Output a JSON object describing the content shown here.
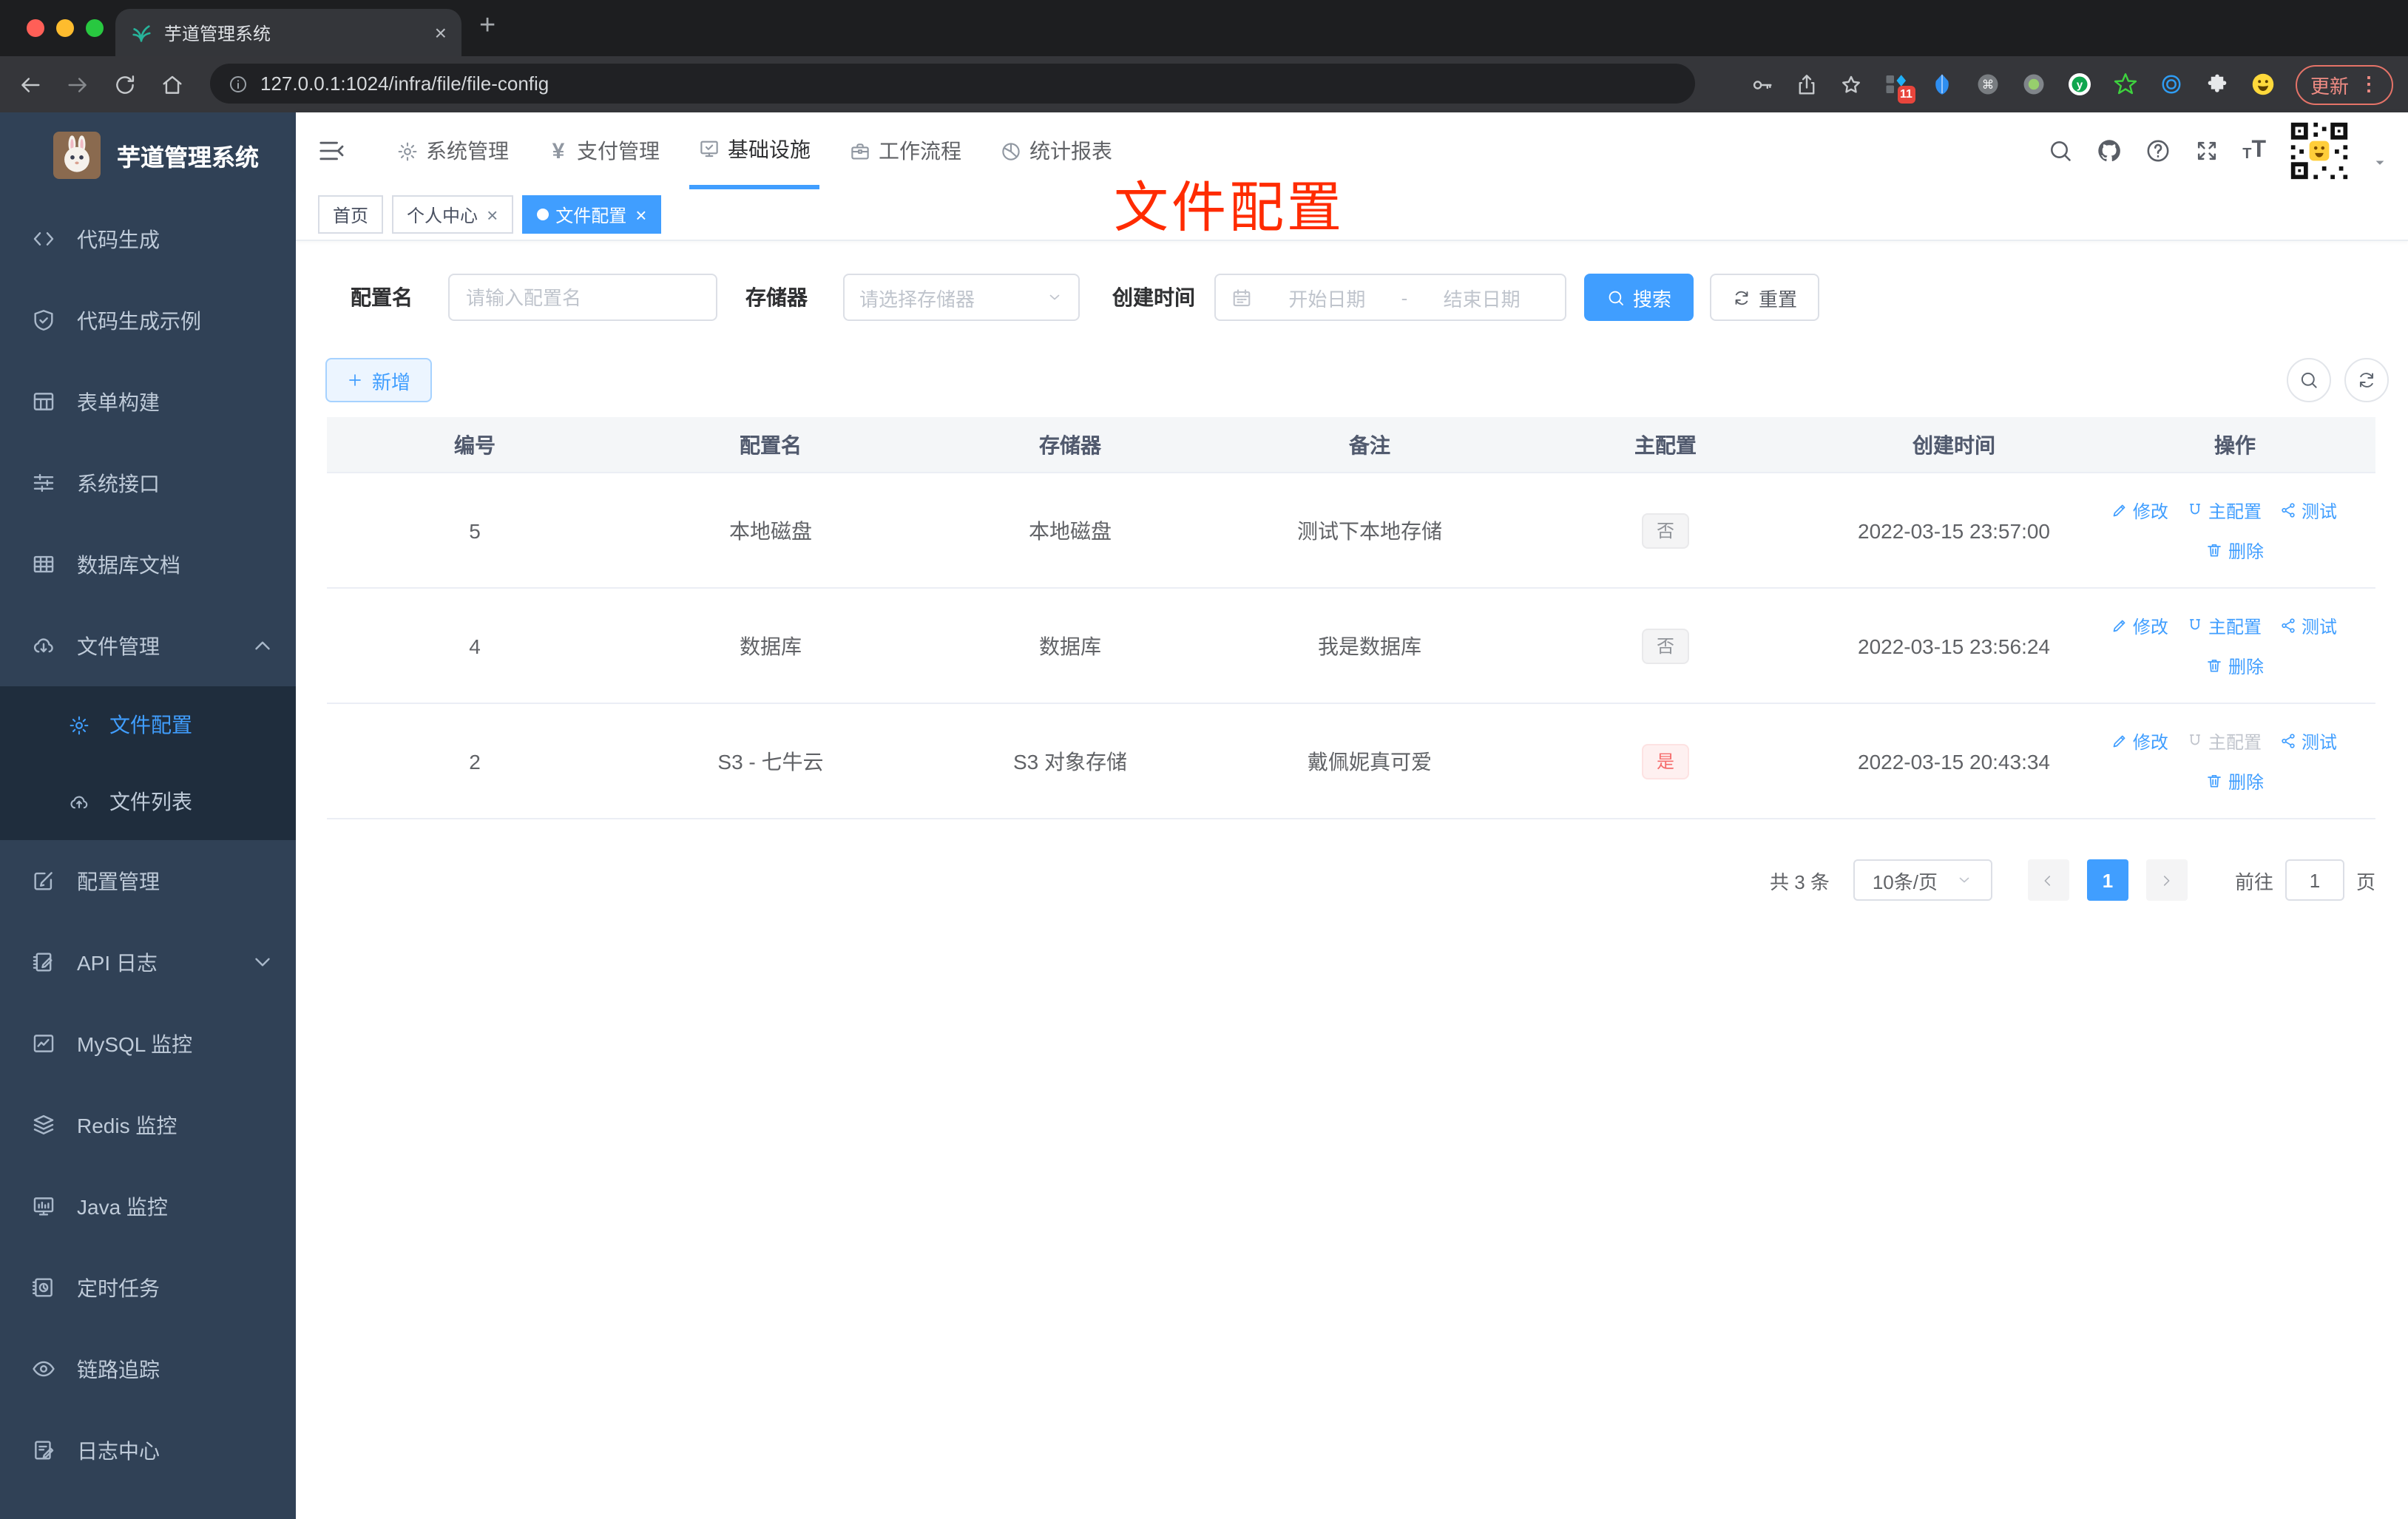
{
  "colors": {
    "accent": "#409eff",
    "danger": "#f56c6c",
    "annotation_red": "#ff2b00",
    "sidebar_bg": "#304156",
    "submenu_bg": "#1f2d3d"
  },
  "browser": {
    "tab": {
      "title": "芋道管理系统",
      "favicon": "plant-icon",
      "close_label": "×"
    },
    "url": "127.0.0.1:1024/infra/file/file-config",
    "update_button": "更新",
    "extensions": [
      {
        "icon": "ext-grid-diamond-icon",
        "badge": "11"
      },
      {
        "icon": "kite-icon"
      },
      {
        "icon": "command-circle-icon"
      },
      {
        "icon": "dot-circle-icon"
      },
      {
        "icon": "y-circle-icon"
      },
      {
        "icon": "green-star-icon"
      },
      {
        "icon": "rings-icon"
      },
      {
        "icon": "puzzle-icon"
      },
      {
        "icon": "emoji-face-icon"
      }
    ]
  },
  "sidebar": {
    "logo_title": "芋道管理系统",
    "items": [
      {
        "icon": "code-icon",
        "label": "代码生成"
      },
      {
        "icon": "shield-check-icon",
        "label": "代码生成示例"
      },
      {
        "icon": "form-grid-icon",
        "label": "表单构建"
      },
      {
        "icon": "sliders-icon",
        "label": "系统接口"
      },
      {
        "icon": "table-icon",
        "label": "数据库文档"
      },
      {
        "icon": "cloud-download-icon",
        "label": "文件管理",
        "chevron": "up",
        "children": [
          {
            "icon": "gear-icon",
            "label": "文件配置",
            "active": true
          },
          {
            "icon": "cloud-upload-icon",
            "label": "文件列表"
          }
        ]
      },
      {
        "icon": "edit-square-icon",
        "label": "配置管理"
      },
      {
        "icon": "journal-pen-icon",
        "label": "API 日志",
        "chevron": "down"
      },
      {
        "icon": "chart-board-icon",
        "label": "MySQL 监控"
      },
      {
        "icon": "layers-icon",
        "label": "Redis 监控"
      },
      {
        "icon": "monitor-icon",
        "label": "Java 监控"
      },
      {
        "icon": "schedule-icon",
        "label": "定时任务"
      },
      {
        "icon": "eye-icon",
        "label": "链路追踪"
      },
      {
        "icon": "log-pen-icon",
        "label": "日志中心"
      }
    ]
  },
  "topnav": {
    "items": [
      {
        "icon": "gear-icon",
        "label": "系统管理"
      },
      {
        "icon": "yen-icon",
        "label": "支付管理"
      },
      {
        "icon": "monitor-check-icon",
        "label": "基础设施",
        "active": true
      },
      {
        "icon": "briefcase-icon",
        "label": "工作流程"
      },
      {
        "icon": "dashboard-icon",
        "label": "统计报表"
      }
    ]
  },
  "tags": {
    "items": [
      {
        "label": "首页"
      },
      {
        "label": "个人中心",
        "closable": true
      },
      {
        "label": "文件配置",
        "active": true,
        "closable": true
      }
    ],
    "close_label": "×"
  },
  "annotation": "文件配置",
  "filters": {
    "name_label": "配置名",
    "name_placeholder": "请输入配置名",
    "storage_label": "存储器",
    "storage_placeholder": "请选择存储器",
    "time_label": "创建时间",
    "start_placeholder": "开始日期",
    "separator": "-",
    "end_placeholder": "结束日期",
    "search_label": "搜索",
    "reset_label": "重置"
  },
  "toolbar": {
    "add_label": "新增"
  },
  "table": {
    "headers": [
      "编号",
      "配置名",
      "存储器",
      "备注",
      "主配置",
      "创建时间",
      "操作"
    ],
    "rows": [
      {
        "id": "5",
        "name": "本地磁盘",
        "storage": "本地磁盘",
        "remark": "测试下本地存储",
        "master": "否",
        "master_type": "info",
        "created": "2022-03-15 23:57:00",
        "actions": [
          {
            "label": "修改",
            "icon": "pen-icon",
            "line": 1
          },
          {
            "label": "主配置",
            "icon": "magnet-icon",
            "line": 1
          },
          {
            "label": "测试",
            "icon": "share-icon",
            "line": 1
          },
          {
            "label": "删除",
            "icon": "trash-icon",
            "line": 2
          }
        ]
      },
      {
        "id": "4",
        "name": "数据库",
        "storage": "数据库",
        "remark": "我是数据库",
        "master": "否",
        "master_type": "info",
        "created": "2022-03-15 23:56:24",
        "actions": [
          {
            "label": "修改",
            "icon": "pen-icon",
            "line": 1
          },
          {
            "label": "主配置",
            "icon": "magnet-icon",
            "line": 1
          },
          {
            "label": "测试",
            "icon": "share-icon",
            "line": 1
          },
          {
            "label": "删除",
            "icon": "trash-icon",
            "line": 2
          }
        ]
      },
      {
        "id": "2",
        "name": "S3 - 七牛云",
        "storage": "S3 对象存储",
        "remark": "戴佩妮真可爱",
        "master": "是",
        "master_type": "danger",
        "created": "2022-03-15 20:43:34",
        "actions": [
          {
            "label": "修改",
            "icon": "pen-icon",
            "line": 1
          },
          {
            "label": "主配置",
            "icon": "magnet-icon",
            "line": 1,
            "disabled": true
          },
          {
            "label": "测试",
            "icon": "share-icon",
            "line": 1
          },
          {
            "label": "删除",
            "icon": "trash-icon",
            "line": 2
          }
        ]
      }
    ]
  },
  "pagination": {
    "total": "共 3 条",
    "page_size": "10条/页",
    "current": "1",
    "goto_label": "前往",
    "goto_value": "1",
    "unit_label": "页"
  }
}
